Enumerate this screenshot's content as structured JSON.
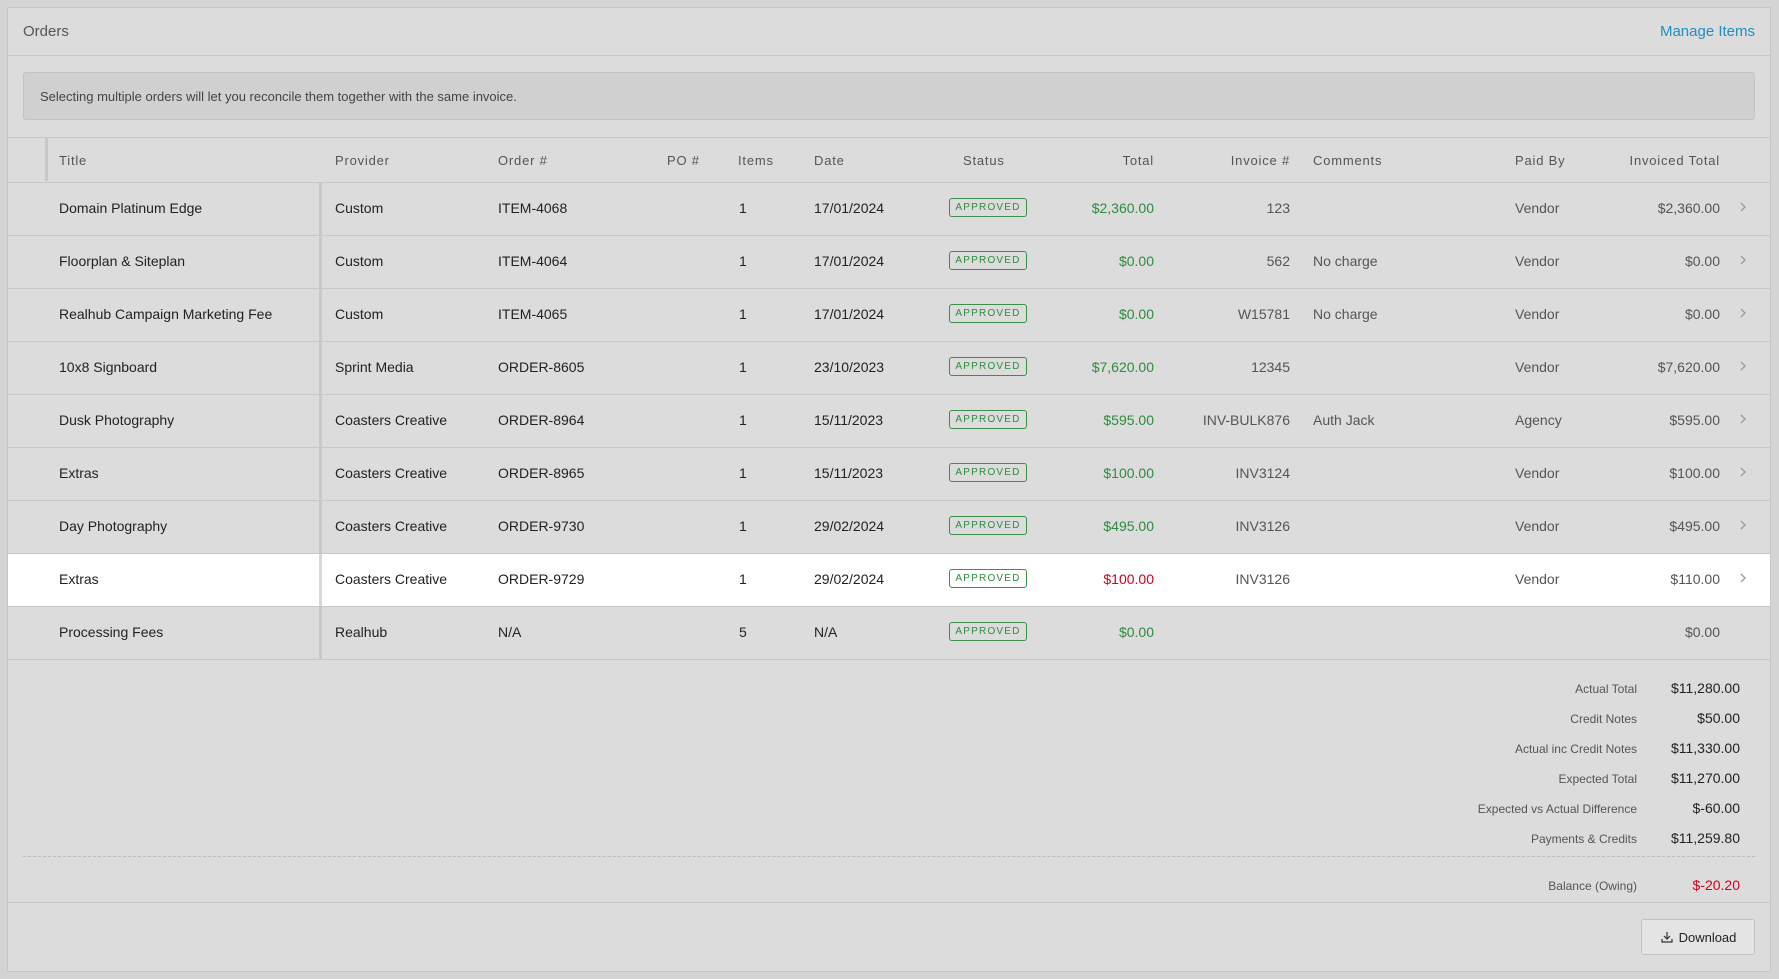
{
  "header": {
    "title": "Orders",
    "manage_label": "Manage Items"
  },
  "notice": "Selecting multiple orders will let you reconcile them together with the same invoice.",
  "columns": {
    "title": "Title",
    "provider": "Provider",
    "order": "Order #",
    "po": "PO #",
    "items": "Items",
    "date": "Date",
    "status": "Status",
    "total": "Total",
    "invoice": "Invoice #",
    "comments": "Comments",
    "paid_by": "Paid By",
    "invoiced_total": "Invoiced Total"
  },
  "rows": [
    {
      "title": "Domain Platinum Edge",
      "provider": "Custom",
      "order": "ITEM-4068",
      "po": "",
      "items": "1",
      "date": "17/01/2024",
      "status": "APPROVED",
      "total": "$2,360.00",
      "invoice": "123",
      "comments": "",
      "paid_by": "Vendor",
      "invoiced_total": "$2,360.00"
    },
    {
      "title": "Floorplan & Siteplan",
      "provider": "Custom",
      "order": "ITEM-4064",
      "po": "",
      "items": "1",
      "date": "17/01/2024",
      "status": "APPROVED",
      "total": "$0.00",
      "invoice": "562",
      "comments": "No charge",
      "paid_by": "Vendor",
      "invoiced_total": "$0.00"
    },
    {
      "title": "Realhub Campaign Marketing Fee",
      "provider": "Custom",
      "order": "ITEM-4065",
      "po": "",
      "items": "1",
      "date": "17/01/2024",
      "status": "APPROVED",
      "total": "$0.00",
      "invoice": "W15781",
      "comments": "No charge",
      "paid_by": "Vendor",
      "invoiced_total": "$0.00"
    },
    {
      "title": "10x8 Signboard",
      "provider": "Sprint Media",
      "order": "ORDER-8605",
      "po": "",
      "items": "1",
      "date": "23/10/2023",
      "status": "APPROVED",
      "total": "$7,620.00",
      "invoice": "12345",
      "comments": "",
      "paid_by": "Vendor",
      "invoiced_total": "$7,620.00"
    },
    {
      "title": "Dusk Photography",
      "provider": "Coasters Creative",
      "order": "ORDER-8964",
      "po": "",
      "items": "1",
      "date": "15/11/2023",
      "status": "APPROVED",
      "total": "$595.00",
      "invoice": "INV-BULK876",
      "comments": "Auth Jack",
      "paid_by": "Agency",
      "invoiced_total": "$595.00"
    },
    {
      "title": "Extras",
      "provider": "Coasters Creative",
      "order": "ORDER-8965",
      "po": "",
      "items": "1",
      "date": "15/11/2023",
      "status": "APPROVED",
      "total": "$100.00",
      "invoice": "INV3124",
      "comments": "",
      "paid_by": "Vendor",
      "invoiced_total": "$100.00"
    },
    {
      "title": "Day Photography",
      "provider": "Coasters Creative",
      "order": "ORDER-9730",
      "po": "",
      "items": "1",
      "date": "29/02/2024",
      "status": "APPROVED",
      "total": "$495.00",
      "invoice": "INV3126",
      "comments": "",
      "paid_by": "Vendor",
      "invoiced_total": "$495.00"
    },
    {
      "title": "Extras",
      "provider": "Coasters Creative",
      "order": "ORDER-9729",
      "po": "",
      "items": "1",
      "date": "29/02/2024",
      "status": "APPROVED",
      "total": "$100.00",
      "invoice": "INV3126",
      "comments": "",
      "paid_by": "Vendor",
      "invoiced_total": "$110.00"
    },
    {
      "title": "Processing Fees",
      "provider": "Realhub",
      "order": "N/A",
      "po": "",
      "items": "5",
      "date": "N/A",
      "status": "APPROVED",
      "total": "$0.00",
      "invoice": "",
      "comments": "",
      "paid_by": "",
      "invoiced_total": "$0.00"
    }
  ],
  "summary": {
    "actual_total": {
      "label": "Actual Total",
      "value": "$11,280.00"
    },
    "credit_notes": {
      "label": "Credit Notes",
      "value": "$50.00"
    },
    "actual_inc_credit": {
      "label": "Actual inc Credit Notes",
      "value": "$11,330.00"
    },
    "expected_total": {
      "label": "Expected Total",
      "value": "$11,270.00"
    },
    "expected_vs_actual": {
      "label": "Expected vs Actual Difference",
      "value": "$-60.00"
    },
    "payments_credits": {
      "label": "Payments & Credits",
      "value": "$11,259.80"
    },
    "balance": {
      "label": "Balance (Owing)",
      "value": "$-20.20"
    }
  },
  "download_label": "Download",
  "colors": {
    "positive": "#2e8b3e",
    "negative": "#d0021b",
    "link": "#1f8fc1"
  }
}
